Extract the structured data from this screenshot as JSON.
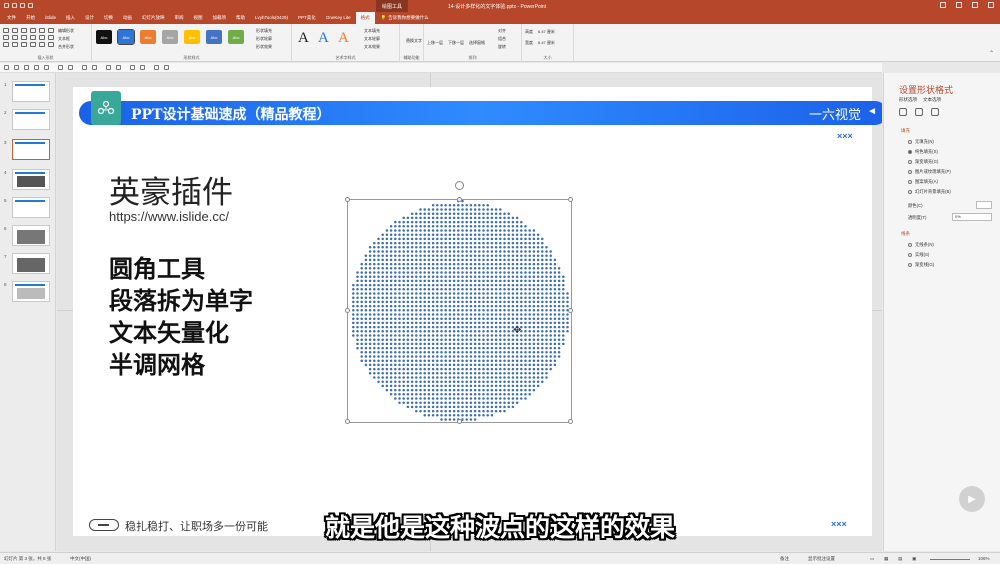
{
  "titlebar": {
    "context_tab": "绘图工具",
    "doc_title": "14-设计多样化的文字体验.pptx - PowerPoint"
  },
  "tabs": [
    {
      "label": "文件"
    },
    {
      "label": "开始"
    },
    {
      "label": "iSlide"
    },
    {
      "label": "插入"
    },
    {
      "label": "设计"
    },
    {
      "label": "切换"
    },
    {
      "label": "动画"
    },
    {
      "label": "幻灯片放映"
    },
    {
      "label": "审阅"
    },
    {
      "label": "视图"
    },
    {
      "label": "加载项"
    },
    {
      "label": "帮助"
    },
    {
      "label": "LvyhTools(0429)"
    },
    {
      "label": "PPT美化"
    },
    {
      "label": "OneKey Lite"
    },
    {
      "label": "格式"
    }
  ],
  "tell_me": "告诉我你想要做什么",
  "ribbon": {
    "groups": {
      "insert_shapes": "插入形状",
      "shape_styles": "形状样式",
      "wordart_styles": "艺术字样式",
      "accessibility": "辅助功能",
      "arrange": "排列",
      "size": "大小"
    },
    "edit_shape": "编辑形状",
    "text_box": "文本框",
    "merge_shapes": "合并形状",
    "shape_fill": "形状填充",
    "shape_outline": "形状轮廓",
    "shape_effects": "形状效果",
    "text_fill": "文本填充",
    "text_outline": "文本轮廓",
    "text_effects": "文本效果",
    "alt_text": "替换文字",
    "bring_forward": "上移一层",
    "send_backward": "下移一层",
    "selection_pane": "选择窗格",
    "align": "对齐",
    "group": "组合",
    "rotate": "旋转",
    "height_label": "高度",
    "height": "6.47 厘米",
    "width_label": "宽度",
    "width": "6.47 厘米",
    "style_swatch_text": "Abc",
    "wordart_glyph": "A"
  },
  "slide": {
    "banner_title": "PPT设计基础速成（精品教程）",
    "banner_brand": "一六视觉",
    "banner_arrow": "◄",
    "xxx": "×××",
    "plugin_title": "英豪插件",
    "plugin_url": "https://www.islide.cc/",
    "features": [
      "圆角工具",
      "段落拆为单字",
      "文本矢量化",
      "半调网格"
    ],
    "slogan": "稳扎稳打、让职场多一份可能"
  },
  "pane": {
    "title": "设置形状格式",
    "tab_shape": "形状选项",
    "tab_text": "文本选项",
    "fill_section": "填充",
    "fill_options": [
      "无填充(N)",
      "纯色填充(S)",
      "渐变填充(G)",
      "图片或纹理填充(P)",
      "图案填充(A)",
      "幻灯片背景填充(B)"
    ],
    "fill_selected": 1,
    "color_label": "颜色(C)",
    "transparency_label": "透明度(T)",
    "transparency": "0%",
    "line_section": "线条",
    "line_options": [
      "无线条(N)",
      "实线(S)",
      "渐变线(G)"
    ]
  },
  "status": {
    "slide_info": "幻灯片 第 3 张，共 8 张",
    "language": "中文(中国)",
    "notes": "备注",
    "comments": "显示批注设置",
    "zoom": "106%"
  },
  "subtitle": "就是他是这种波点的这样的效果",
  "colors": {
    "accent": "#b7472a",
    "banner": "#1b61e8",
    "dots": "#3d6fb0"
  }
}
